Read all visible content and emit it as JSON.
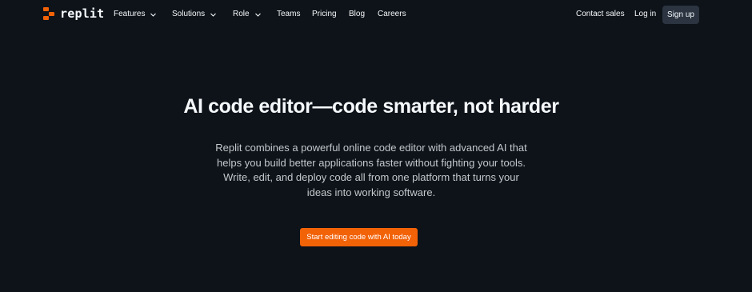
{
  "brand": {
    "name": "replit",
    "accent": "#f26207"
  },
  "nav": {
    "items": [
      {
        "label": "Features",
        "dropdown": true
      },
      {
        "label": "Solutions",
        "dropdown": true
      },
      {
        "label": "Role",
        "dropdown": true
      },
      {
        "label": "Teams",
        "dropdown": false
      },
      {
        "label": "Pricing",
        "dropdown": false
      },
      {
        "label": "Blog",
        "dropdown": false
      },
      {
        "label": "Careers",
        "dropdown": false
      }
    ],
    "contact_sales": "Contact sales",
    "log_in": "Log in",
    "sign_up": "Sign up"
  },
  "hero": {
    "title": "AI code editor—code smarter, not harder",
    "subtitle_lines": [
      "Replit combines a powerful online code editor with advanced AI that",
      "helps you build better applications faster without fighting your tools.",
      "Write, edit, and deploy code all from one platform that turns your",
      "ideas into working software."
    ],
    "cta_label": "Start editing code with AI today"
  },
  "colors": {
    "background": "#0e1319",
    "text": "#f5f9fc",
    "muted_text": "#c2c8cc",
    "signup_bg": "#2b3440"
  }
}
